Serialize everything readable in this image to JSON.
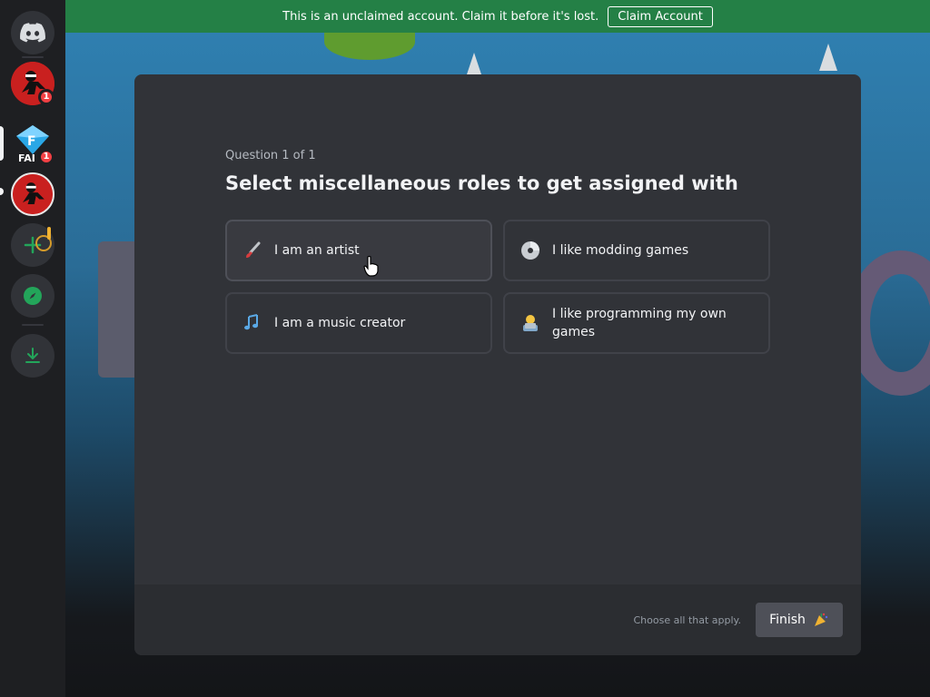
{
  "notice": {
    "text": "This is an unclaimed account. Claim it before it's lost.",
    "claim_label": "Claim Account"
  },
  "servers": [
    {
      "name": "Discord home",
      "icon": "discord-logo-icon"
    },
    {
      "name": "Server A",
      "badge": "1"
    },
    {
      "name": "Server B (FAI)",
      "badge": "1",
      "text": "FAI"
    },
    {
      "name": "Server C"
    },
    {
      "name": "Add a server",
      "icon": "plus-icon"
    },
    {
      "name": "Explore discoverable servers",
      "icon": "compass-icon"
    },
    {
      "name": "Download apps",
      "icon": "download-icon"
    }
  ],
  "onboarding": {
    "question_count": "Question 1 of 1",
    "question_title": "Select miscellaneous roles to get assigned with",
    "options": [
      {
        "label": "I am an artist",
        "icon": "paintbrush-icon"
      },
      {
        "label": "I like modding games",
        "icon": "disc-icon"
      },
      {
        "label": "I am a music creator",
        "icon": "music-notes-icon"
      },
      {
        "label": "I like programming my own games",
        "icon": "technologist-icon"
      }
    ],
    "hint": "Choose all that apply.",
    "finish_label": "Finish",
    "finish_icon": "party-popper-icon"
  },
  "colors": {
    "notice_bg": "#248046",
    "modal_bg": "#313338",
    "footer_bg": "#2b2d31",
    "badge": "#f23f43",
    "green_icon": "#23a55a"
  }
}
